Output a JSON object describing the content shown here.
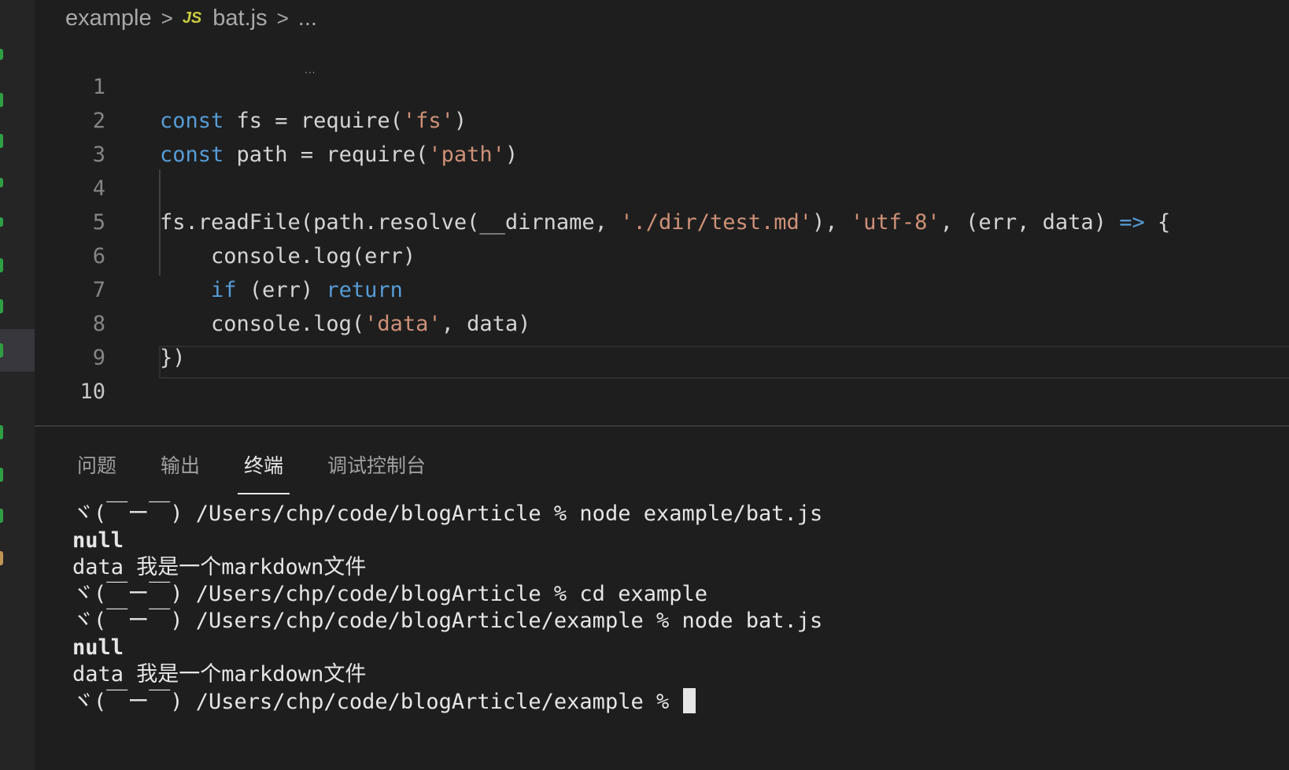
{
  "breadcrumb": {
    "folder": "example",
    "file_icon": "JS",
    "file": "bat.js",
    "more": "..."
  },
  "editor": {
    "lines": [
      {
        "num": "1"
      },
      {
        "num": "2"
      },
      {
        "num": "3"
      },
      {
        "num": "4"
      },
      {
        "num": "5"
      },
      {
        "num": "6"
      },
      {
        "num": "7"
      },
      {
        "num": "8"
      },
      {
        "num": "9"
      },
      {
        "num": "10"
      }
    ],
    "code": {
      "l1_kw": "const",
      "l1_rest": " fs = require(",
      "l1_str": "'fs'",
      "l1_end": ")",
      "l2_kw": "const",
      "l2_rest": " path = require(",
      "l2_str": "'path'",
      "l2_end": ")",
      "l4_a": "fs.readFile(path.resolve(__dirname, ",
      "l4_str1": "'./dir/test.md'",
      "l4_b": "), ",
      "l4_str2": "'utf-8'",
      "l4_c": ", (err, data) ",
      "l4_arrow": "=>",
      "l4_d": " {",
      "l5": "    console.log(err)",
      "l6_indent": "    ",
      "l6_kw1": "if",
      "l6_mid": " (err) ",
      "l6_kw2": "return",
      "l7_a": "    console.log(",
      "l7_str": "'data'",
      "l7_b": ", data)",
      "l8": "})"
    },
    "hint_dots": "..."
  },
  "panel": {
    "tabs": [
      "问题",
      "输出",
      "终端",
      "调试控制台"
    ],
    "active_tab": 2,
    "terminal": [
      "ヾ(￣ー￣) /Users/chp/code/blogArticle % node example/bat.js",
      "null",
      "data 我是一个markdown文件",
      "ヾ(￣ー￣) /Users/chp/code/blogArticle % cd example",
      "ヾ(￣ー￣) /Users/chp/code/blogArticle/example % node bat.js",
      "null",
      "data 我是一个markdown文件",
      "ヾ(￣ー￣) /Users/chp/code/blogArticle/example % "
    ]
  },
  "colors": {
    "keyword": "#569cd6",
    "string": "#ce9178",
    "scm_added": "#2ea043",
    "scm_modified": "#c09553"
  }
}
